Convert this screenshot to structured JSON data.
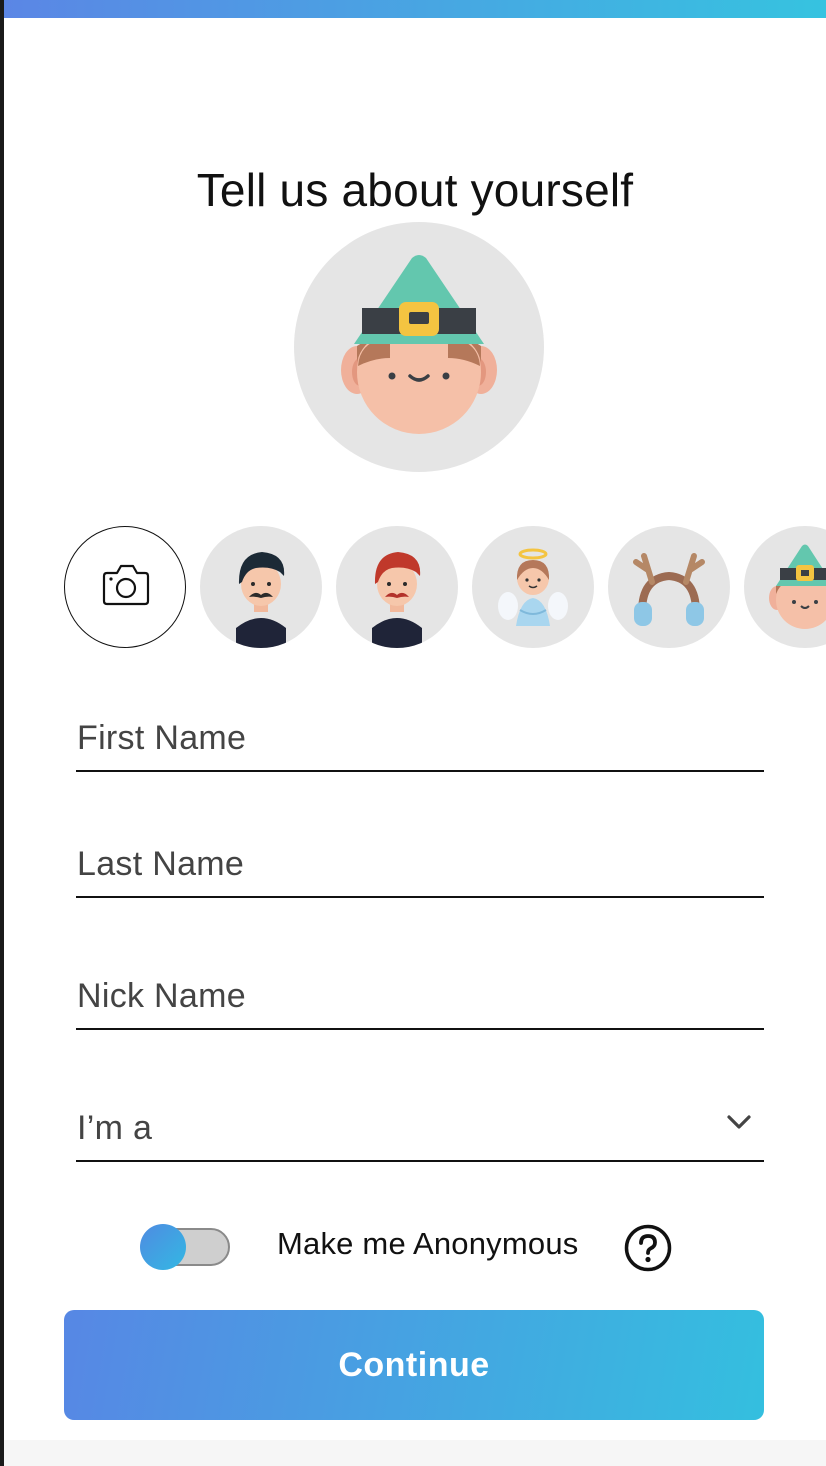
{
  "page": {
    "title": "Tell us about yourself"
  },
  "avatar": {
    "selected_icon": "elf-avatar-icon",
    "options": [
      {
        "icon": "camera-icon"
      },
      {
        "icon": "man-mustache-dark-hair-icon"
      },
      {
        "icon": "man-mustache-red-hair-icon"
      },
      {
        "icon": "angel-girl-icon"
      },
      {
        "icon": "reindeer-headband-icon"
      },
      {
        "icon": "elf-avatar-icon"
      }
    ]
  },
  "form": {
    "first_name": {
      "placeholder": "First Name",
      "value": ""
    },
    "last_name": {
      "placeholder": "Last Name",
      "value": ""
    },
    "nick_name": {
      "placeholder": "Nick Name",
      "value": ""
    },
    "role_select": {
      "placeholder": "I’m a",
      "value": ""
    }
  },
  "anonymous": {
    "label": "Make me Anonymous",
    "enabled": false,
    "help_icon": "question-circle-icon"
  },
  "actions": {
    "continue_label": "Continue"
  },
  "colors": {
    "gradient_start": "#5787e4",
    "gradient_end": "#34bfdf",
    "avatar_bg": "#e5e5e5",
    "elf_hat": "#63c7ae",
    "skin": "#f5c0a8"
  }
}
